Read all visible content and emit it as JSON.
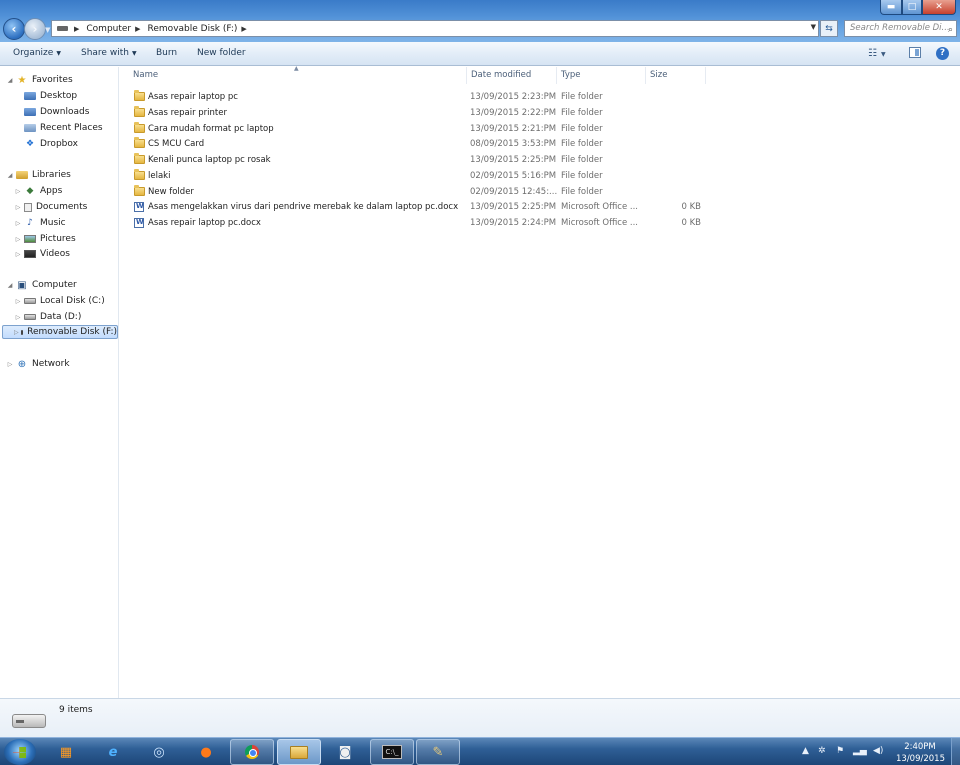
{
  "address": {
    "crumbs": [
      "Computer",
      "Removable Disk (F:)"
    ],
    "search_placeholder": "Search Removable Di..."
  },
  "window_controls": {
    "minimize": "▬",
    "maximize": "□",
    "close": "✕"
  },
  "toolbar": {
    "organize": "Organize",
    "share_with": "Share with",
    "burn": "Burn",
    "new_folder": "New folder",
    "help": "?"
  },
  "nav": {
    "favorites": "Favorites",
    "desktop": "Desktop",
    "downloads": "Downloads",
    "recent_places": "Recent Places",
    "dropbox": "Dropbox",
    "libraries": "Libraries",
    "apps": "Apps",
    "documents": "Documents",
    "music": "Music",
    "pictures": "Pictures",
    "videos": "Videos",
    "computer": "Computer",
    "local_disk": "Local Disk (C:)",
    "data_disk": "Data (D:)",
    "removable_disk": "Removable Disk (F:)",
    "network": "Network"
  },
  "columns": {
    "name": "Name",
    "date_modified": "Date modified",
    "type": "Type",
    "size": "Size"
  },
  "files": [
    {
      "name": "Asas repair laptop pc",
      "date": "13/09/2015 2:23:PM",
      "type": "File folder",
      "size": "",
      "kind": "folder"
    },
    {
      "name": "Asas repair printer",
      "date": "13/09/2015 2:22:PM",
      "type": "File folder",
      "size": "",
      "kind": "folder"
    },
    {
      "name": "Cara mudah format pc laptop",
      "date": "13/09/2015 2:21:PM",
      "type": "File folder",
      "size": "",
      "kind": "folder"
    },
    {
      "name": "CS MCU Card",
      "date": "08/09/2015 3:53:PM",
      "type": "File folder",
      "size": "",
      "kind": "folder"
    },
    {
      "name": "Kenali punca laptop pc rosak",
      "date": "13/09/2015 2:25:PM",
      "type": "File folder",
      "size": "",
      "kind": "folder"
    },
    {
      "name": "lelaki",
      "date": "02/09/2015 5:16:PM",
      "type": "File folder",
      "size": "",
      "kind": "folder"
    },
    {
      "name": "New folder",
      "date": "02/09/2015 12:45:...",
      "type": "File folder",
      "size": "",
      "kind": "folder"
    },
    {
      "name": "Asas mengelakkan virus dari pendrive merebak ke dalam laptop pc.docx",
      "date": "13/09/2015 2:25:PM",
      "type": "Microsoft Office ...",
      "size": "0 KB",
      "kind": "docx"
    },
    {
      "name": "Asas repair laptop pc.docx",
      "date": "13/09/2015 2:24:PM",
      "type": "Microsoft Office ...",
      "size": "0 KB",
      "kind": "docx"
    }
  ],
  "status": {
    "item_count": "9 items"
  },
  "taskbar": {
    "cmd_label": "C:\\_",
    "time": "2:40PM",
    "date": "13/09/2015"
  },
  "colors": {
    "accent": "#3a7bc8",
    "taskbar": "#2f5f96",
    "selection": "#c2dcfd"
  }
}
